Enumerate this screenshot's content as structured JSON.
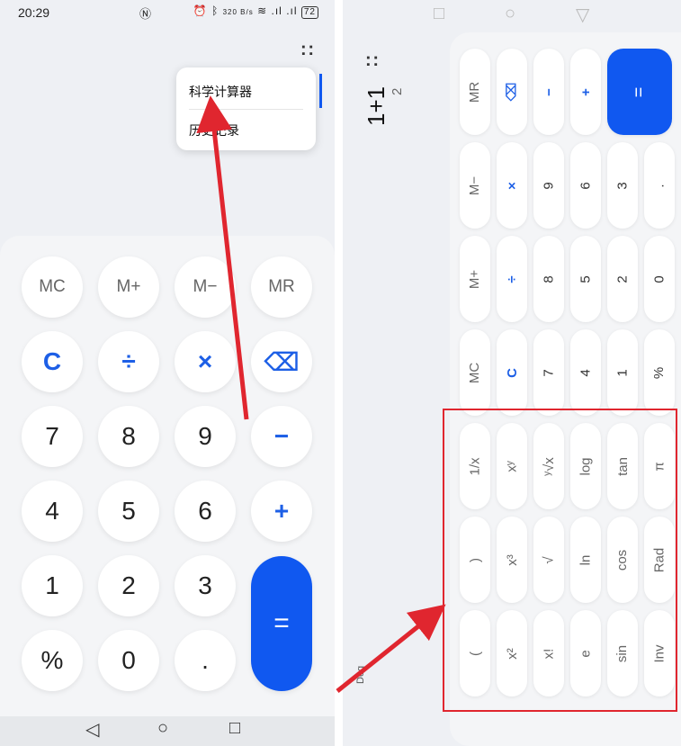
{
  "left": {
    "status": {
      "time": "20:29",
      "net_speed": "320 B/s",
      "battery": "72"
    },
    "menu": {
      "scientific": "科学计算器",
      "history": "历史记录"
    },
    "keys": {
      "mc": "MC",
      "mplus": "M+",
      "mminus": "M−",
      "mr": "MR",
      "c": "C",
      "div": "÷",
      "mul": "×",
      "del": "⌫",
      "k7": "7",
      "k8": "8",
      "k9": "9",
      "minus": "−",
      "k4": "4",
      "k5": "5",
      "k6": "6",
      "plus": "+",
      "k1": "1",
      "k2": "2",
      "k3": "3",
      "eq": "=",
      "pct": "%",
      "k0": "0",
      "dot": "."
    }
  },
  "right": {
    "expression": "1+1",
    "result": "2",
    "mode": "Deg",
    "keys": {
      "mr": "MR",
      "del": "⌫",
      "minus": "−",
      "plus": "+",
      "eq": "=",
      "mminus": "M−",
      "mul": "×",
      "k9": "9",
      "k6": "6",
      "k3": "3",
      "dot": ".",
      "mplus": "M+",
      "div": "÷",
      "k8": "8",
      "k5": "5",
      "k2": "2",
      "k0": "0",
      "mc": "MC",
      "c": "C",
      "k7": "7",
      "k4": "4",
      "k1": "1",
      "pct": "%",
      "recip": "1/x",
      "pow": "xʸ",
      "root": "ʸ√x",
      "log": "log",
      "tan": "tan",
      "pi": "π",
      "rparen": ")",
      "cube": "x³",
      "sqrt": "√",
      "ln": "ln",
      "cos": "cos",
      "rad": "Rad",
      "lparen": "(",
      "square": "x²",
      "fact": "x!",
      "e": "e",
      "sin": "sin",
      "inv": "Inv"
    }
  },
  "colors": {
    "accent": "#1058f0",
    "annotation": "#e0262f"
  }
}
